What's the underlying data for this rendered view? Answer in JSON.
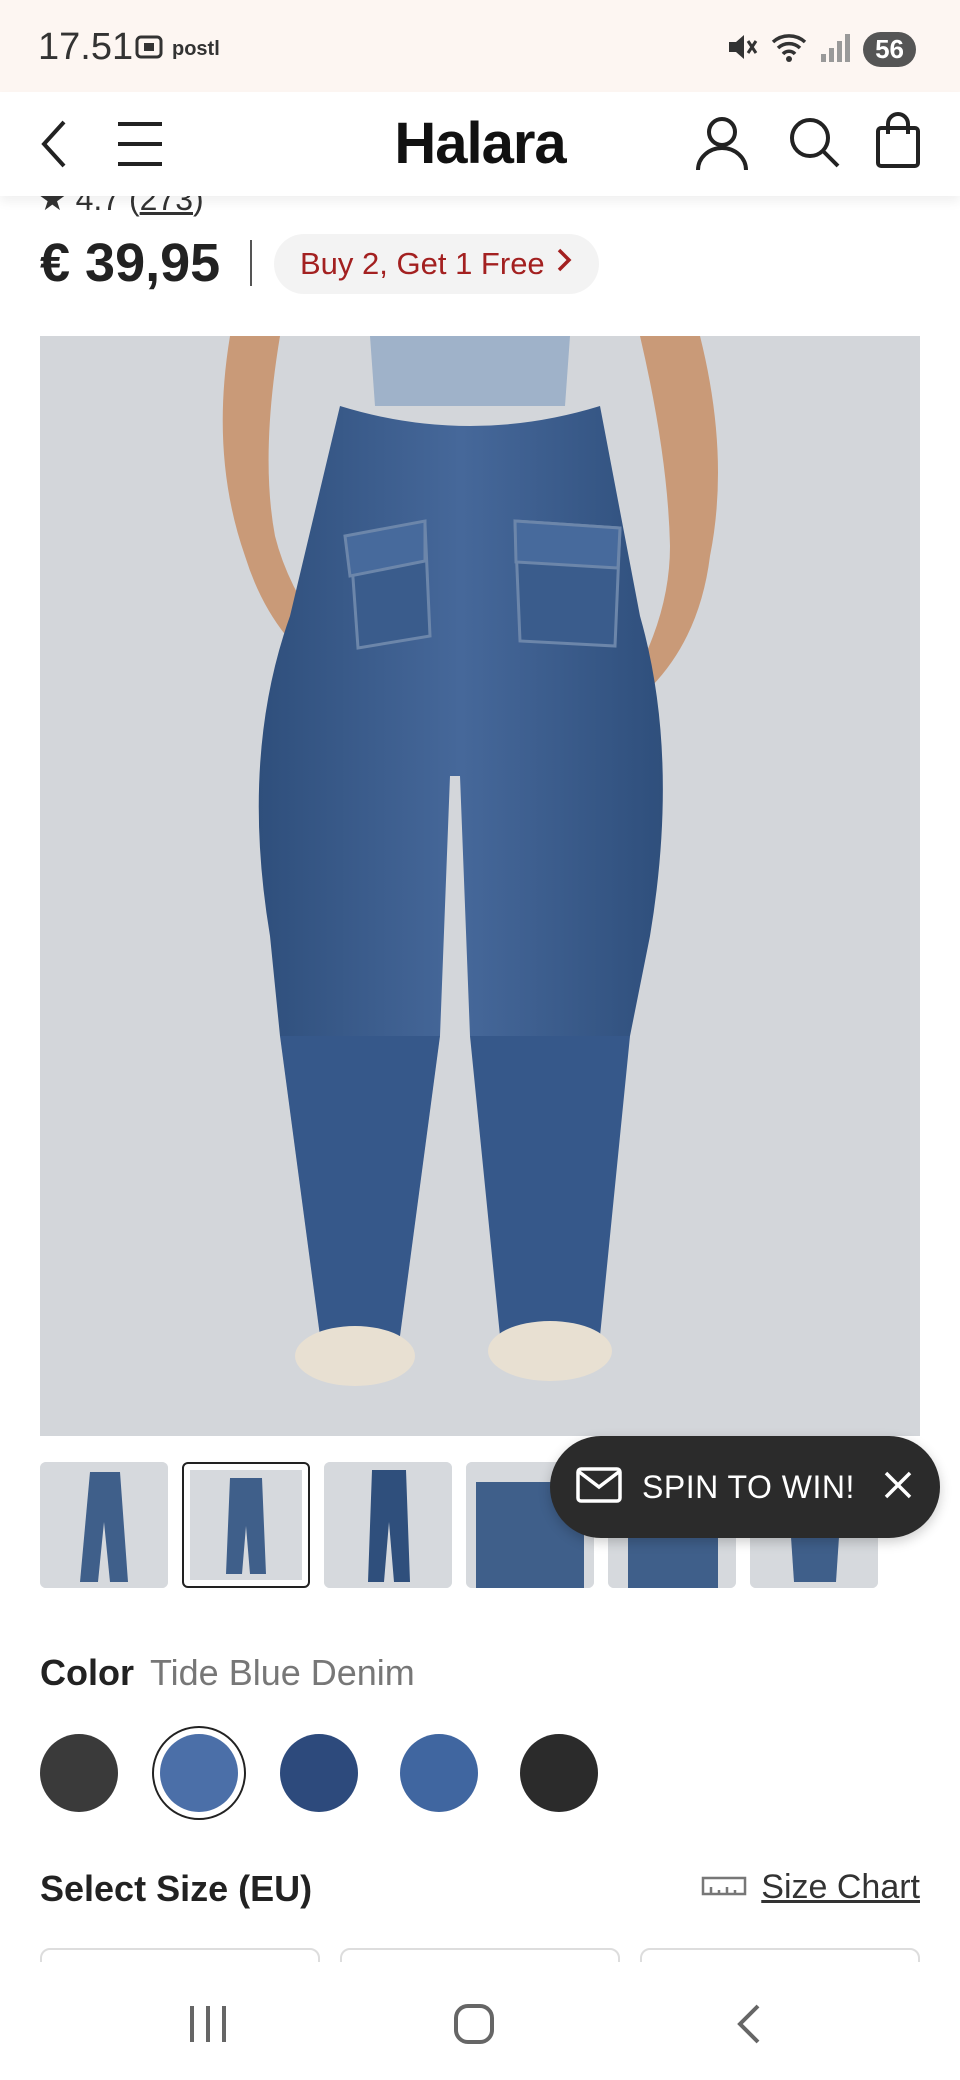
{
  "status_bar": {
    "time": "17.51",
    "app_label": "postl",
    "battery": "56"
  },
  "header": {
    "brand": "Halara",
    "icons": [
      "back-icon",
      "menu-icon",
      "user-icon",
      "search-icon",
      "bag-icon"
    ]
  },
  "product": {
    "rating": "4.7",
    "review_count": "273",
    "price": "€ 39,95",
    "promo_label": "Buy 2, Get 1 Free"
  },
  "popup": {
    "spin_label": "SPIN TO WIN!"
  },
  "color": {
    "label": "Color",
    "selected_value": "Tide Blue Denim",
    "swatches": [
      "#3a3a3a",
      "#4b6fa8",
      "#2d4a7c",
      "#4066a0",
      "#2b2b2b"
    ]
  },
  "size": {
    "label": "Select Size (EU)",
    "chart_link": "Size Chart"
  },
  "colors": {
    "brand_red": "#a32020",
    "denim": "#3f5f8a",
    "popup_bg": "#2b2b2b"
  }
}
